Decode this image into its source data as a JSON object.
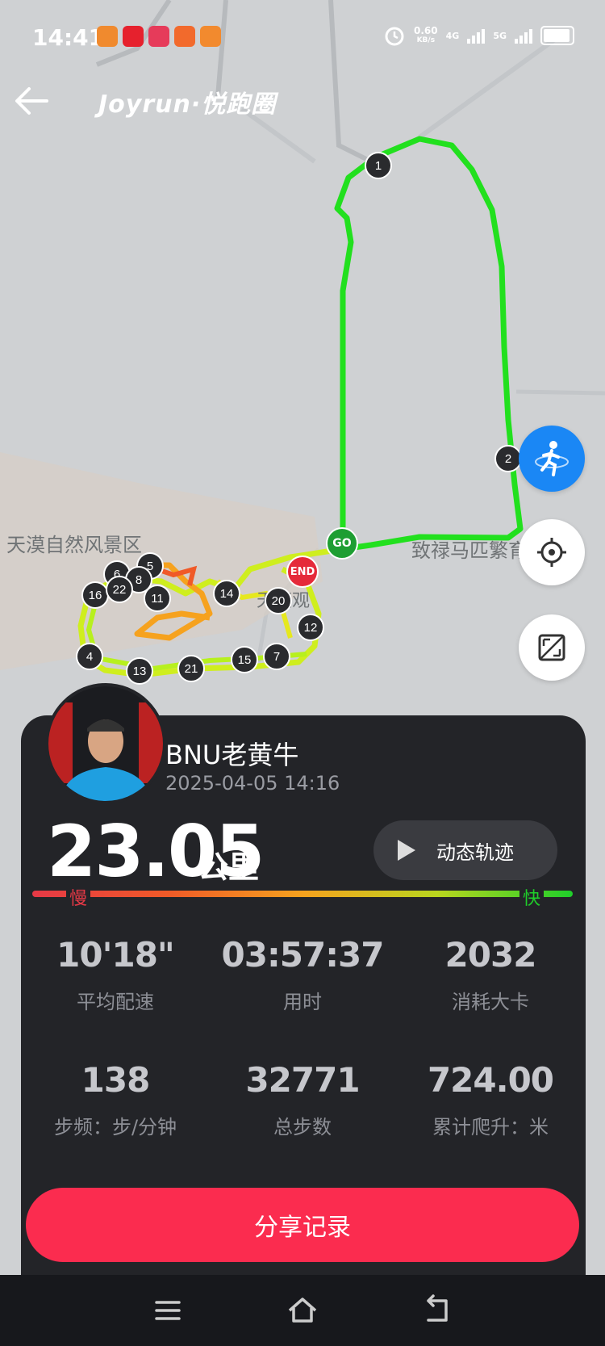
{
  "status_bar": {
    "time": "14:41",
    "net_speed_value": "0.60",
    "net_speed_unit": "KB/s",
    "signal_1": "4G",
    "signal_2": "5G"
  },
  "header": {
    "brand": "Joyrun·悦跑圈"
  },
  "map": {
    "places": [
      "天漠自然风景区",
      "致禄马匹繁育场",
      "天漠观"
    ],
    "start_marker": "GO",
    "end_marker": "END",
    "km_markers": [
      "1",
      "2",
      "4",
      "5",
      "6",
      "7",
      "8",
      "11",
      "12",
      "13",
      "14",
      "15",
      "16",
      "20",
      "21",
      "22"
    ]
  },
  "user": {
    "name": "BNU老黄牛",
    "datetime": "2025-04-05 14:16"
  },
  "run": {
    "distance": "23.05",
    "distance_unit": "公里",
    "replay_label": "动态轨迹",
    "pace_slow": "慢",
    "pace_fast": "快"
  },
  "stats": [
    {
      "value": "10'18\"",
      "label": "平均配速"
    },
    {
      "value": "03:57:37",
      "label": "用时"
    },
    {
      "value": "2032",
      "label": "消耗大卡"
    },
    {
      "value": "138",
      "label": "步频：步/分钟"
    },
    {
      "value": "32771",
      "label": "总步数"
    },
    {
      "value": "724.00",
      "label": "累计爬升：米"
    }
  ],
  "share_label": "分享记录",
  "colors": {
    "accent": "#fb2c4f",
    "route": "#22e01e",
    "fab": "#1a87f5"
  }
}
